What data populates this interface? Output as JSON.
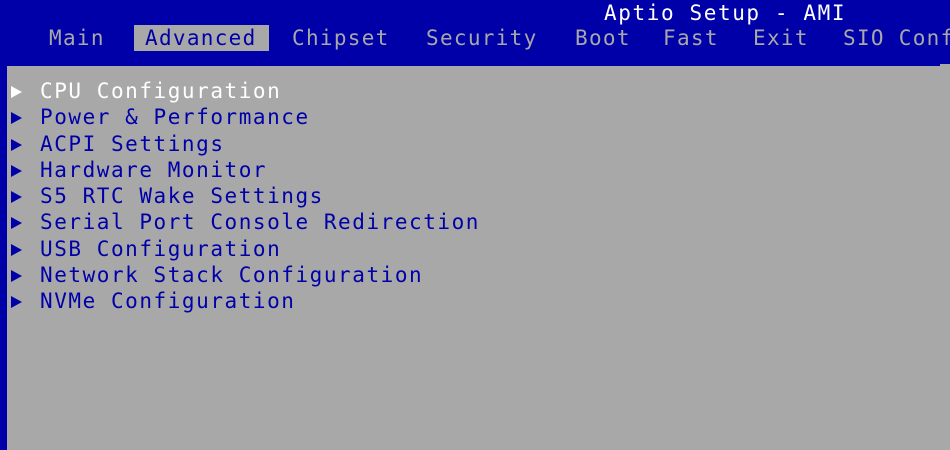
{
  "header": {
    "title": "Aptio Setup - AMI",
    "tabs": [
      {
        "label": "Main"
      },
      {
        "label": "Advanced"
      },
      {
        "label": "Chipset"
      },
      {
        "label": "Security"
      },
      {
        "label": "Boot"
      },
      {
        "label": "Fast"
      },
      {
        "label": "Exit"
      },
      {
        "label": "SIO Conf"
      }
    ],
    "active_tab": "Advanced"
  },
  "menu": {
    "items": [
      {
        "label": "CPU Configuration",
        "icon": "right-triangle-icon"
      },
      {
        "label": "Power & Performance",
        "icon": "right-triangle-icon"
      },
      {
        "label": "ACPI Settings",
        "icon": "right-triangle-icon"
      },
      {
        "label": "Hardware Monitor",
        "icon": "right-triangle-icon"
      },
      {
        "label": "S5 RTC Wake Settings",
        "icon": "right-triangle-icon"
      },
      {
        "label": "Serial Port Console Redirection",
        "icon": "right-triangle-icon"
      },
      {
        "label": "USB Configuration",
        "icon": "right-triangle-icon"
      },
      {
        "label": "Network Stack Configuration",
        "icon": "right-triangle-icon"
      },
      {
        "label": "NVMe Configuration",
        "icon": "right-triangle-icon"
      }
    ],
    "selected_item": "CPU Configuration"
  },
  "colors": {
    "background": "#0000a8",
    "panel": "#a8a8a8",
    "text_blue": "#0000a8",
    "text_white": "#ffffff"
  }
}
